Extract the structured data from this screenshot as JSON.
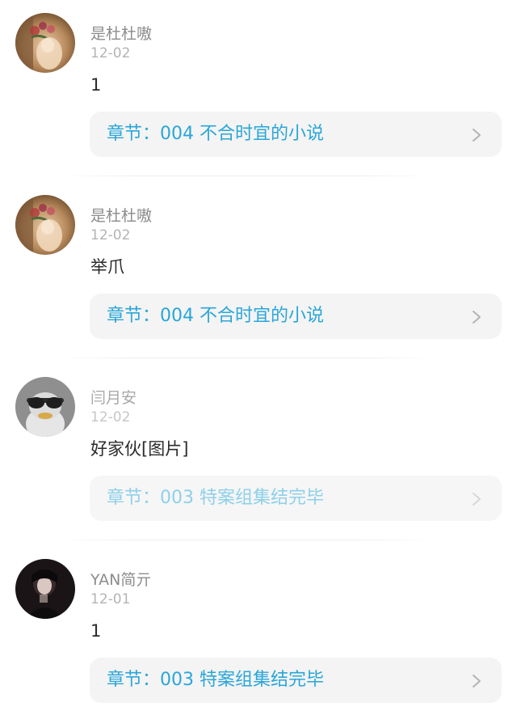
{
  "comments": [
    {
      "avatar": "avatar-flowers-icon",
      "username": "是杜杜嗷",
      "date": "12-02",
      "text": "1",
      "chapter": "章节：004 不合时宜的小说",
      "chevron": "chevron-right-icon"
    },
    {
      "avatar": "avatar-flowers-icon",
      "username": "是杜杜嗷",
      "date": "12-02",
      "text": "举爪",
      "chapter": "章节：004 不合时宜的小说",
      "chevron": "chevron-right-icon"
    },
    {
      "avatar": "avatar-duck-sunglasses-icon",
      "username": "闫月安",
      "date": "12-02",
      "text": "好家伙[图片]",
      "chapter": "章节：003 特案组集结完毕",
      "chevron": "chevron-right-icon"
    },
    {
      "avatar": "avatar-dark-portrait-icon",
      "username": "YAN简亓",
      "date": "12-01",
      "text": "1",
      "chapter": "章节：003 特案组集结完毕",
      "chevron": "chevron-right-icon"
    }
  ],
  "colors": {
    "chapter_text": "#2aa6d8",
    "card_background": "#f4f4f4",
    "username": "#8c8c8c",
    "date": "#b4b4b4"
  }
}
